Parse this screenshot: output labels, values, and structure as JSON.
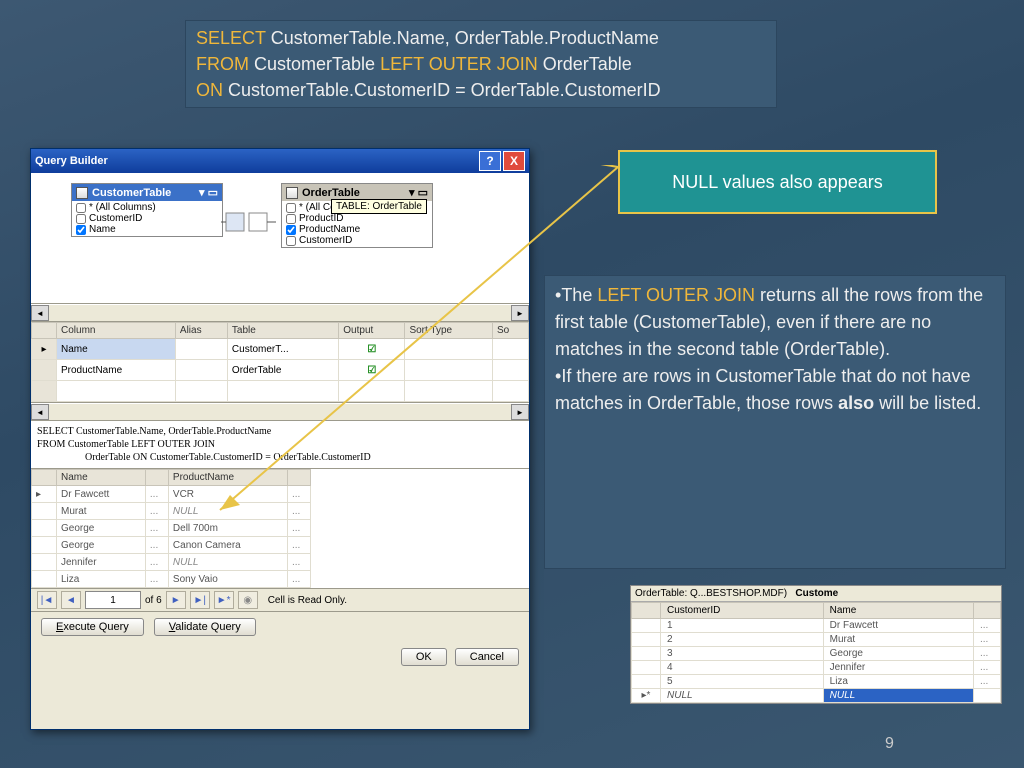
{
  "sql": {
    "select_kw": "SELECT",
    "select_cols": " CustomerTable.Name, OrderTable.ProductName",
    "from_kw": "FROM",
    "from_tbl": " CustomerTable ",
    "join_kw": "LEFT OUTER JOIN",
    "join_tbl": " OrderTable",
    "on_kw": "ON",
    "on_cond": " CustomerTable.CustomerID = OrderTable.CustomerID"
  },
  "callout": "NULL values also appears",
  "explanation": {
    "bullet": "•",
    "p1a": "The ",
    "p1kw": "LEFT OUTER JOIN",
    "p1b": " returns all the rows from the first table (CustomerTable), even if there are no matches in the second table (OrderTable).",
    "p2a": "If there are rows in CustomerTable that do not have matches in OrderTable, those rows ",
    "p2bold": "also",
    "p2b": " will be listed."
  },
  "qb": {
    "title": "Query Builder",
    "help": "?",
    "close": "X",
    "customer": {
      "title": "CustomerTable",
      "rows": [
        "* (All Columns)",
        "CustomerID",
        "Name"
      ],
      "checked": [
        false,
        false,
        true
      ]
    },
    "order": {
      "title": "OrderTable",
      "tooltip": "TABLE: OrderTable",
      "rows": [
        "* (All Columns)",
        "ProductID",
        "ProductName",
        "CustomerID"
      ],
      "checked": [
        false,
        false,
        true,
        false
      ]
    },
    "grid": {
      "headers": [
        "Column",
        "Alias",
        "Table",
        "Output",
        "Sort Type",
        "So"
      ],
      "rows": [
        {
          "col": "Name",
          "alias": "",
          "table": "CustomerT...",
          "output": true
        },
        {
          "col": "ProductName",
          "alias": "",
          "table": "OrderTable",
          "output": true
        }
      ]
    },
    "sqlpane": {
      "l1": "SELECT     CustomerTable.Name, OrderTable.ProductName",
      "l2": "FROM       CustomerTable LEFT OUTER JOIN",
      "l3": "OrderTable ON CustomerTable.CustomerID = OrderTable.CustomerID"
    },
    "results": {
      "headers": [
        "Name",
        "ProductName"
      ],
      "rows": [
        [
          "Dr Fawcett",
          "VCR"
        ],
        [
          "Murat",
          "NULL"
        ],
        [
          "George",
          "Dell 700m"
        ],
        [
          "George",
          "Canon Camera"
        ],
        [
          "Jennifer",
          "NULL"
        ],
        [
          "Liza",
          "Sony Vaio"
        ]
      ]
    },
    "nav": {
      "pos": "1",
      "total": "of 6",
      "status": "Cell is Read Only."
    },
    "buttons": {
      "exec": "Execute Query",
      "validate": "Validate Query",
      "ok": "OK",
      "cancel": "Cancel"
    }
  },
  "mini": {
    "tab1": "OrderTable: Q...BESTSHOP.MDF)",
    "tab2": "Custome",
    "headers": [
      "CustomerID",
      "Name"
    ],
    "rows": [
      [
        "1",
        "Dr Fawcett"
      ],
      [
        "2",
        "Murat"
      ],
      [
        "3",
        "George"
      ],
      [
        "4",
        "Jennifer"
      ],
      [
        "5",
        "Liza"
      ],
      [
        "NULL",
        "NULL"
      ]
    ]
  },
  "page": "9"
}
